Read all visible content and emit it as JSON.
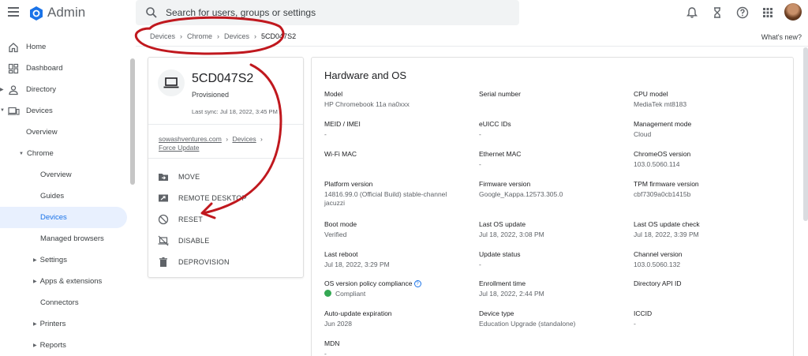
{
  "app": {
    "title": "Admin"
  },
  "search": {
    "placeholder": "Search for users, groups or settings"
  },
  "header_icons": [
    "bell-icon",
    "hourglass-icon",
    "help-icon",
    "apps-grid-icon"
  ],
  "sidebar": {
    "items": [
      {
        "label": "Home"
      },
      {
        "label": "Dashboard"
      },
      {
        "label": "Directory"
      },
      {
        "label": "Devices"
      },
      {
        "label": "Overview"
      },
      {
        "label": "Chrome"
      },
      {
        "label": "Overview"
      },
      {
        "label": "Guides"
      },
      {
        "label": "Devices"
      },
      {
        "label": "Managed browsers"
      },
      {
        "label": "Settings"
      },
      {
        "label": "Apps & extensions"
      },
      {
        "label": "Connectors"
      },
      {
        "label": "Printers"
      },
      {
        "label": "Reports"
      }
    ]
  },
  "breadcrumb": {
    "items": [
      "Devices",
      "Chrome",
      "Devices",
      "5CD047S2"
    ],
    "whats_new": "What's new?"
  },
  "device": {
    "name": "5CD047S2",
    "status": "Provisioned",
    "last_sync": "Last sync: Jul 18, 2022, 3:45 PM",
    "org_path_1": "sowashventures.com",
    "org_path_2": "Devices",
    "org_path_3": "Force Update",
    "actions": [
      "MOVE",
      "REMOTE DESKTOP",
      "RESET",
      "DISABLE",
      "DEPROVISION"
    ]
  },
  "hardware": {
    "title": "Hardware and OS",
    "fields": [
      {
        "key": "Model",
        "value": "HP Chromebook 11a na0xxx"
      },
      {
        "key": "Serial number",
        "value": ""
      },
      {
        "key": "CPU model",
        "value": "MediaTek mt8183"
      },
      {
        "key": "MEID / IMEI",
        "value": "-"
      },
      {
        "key": "eUICC IDs",
        "value": "-"
      },
      {
        "key": "Management mode",
        "value": "Cloud"
      },
      {
        "key": "Wi-Fi MAC",
        "value": ""
      },
      {
        "key": "Ethernet MAC",
        "value": "-"
      },
      {
        "key": "ChromeOS version",
        "value": "103.0.5060.114"
      },
      {
        "key": "Platform version",
        "value": "14816.99.0 (Official Build) stable-channel",
        "value2": "jacuzzi"
      },
      {
        "key": "Firmware version",
        "value": "Google_Kappa.12573.305.0"
      },
      {
        "key": "TPM firmware version",
        "value": "cbf7309a0cb1415b"
      },
      {
        "key": "Boot mode",
        "value": "Verified"
      },
      {
        "key": "Last OS update",
        "value": "Jul 18, 2022, 3:08 PM"
      },
      {
        "key": "Last OS update check",
        "value": "Jul 18, 2022, 3:39 PM"
      },
      {
        "key": "Last reboot",
        "value": "Jul 18, 2022, 3:29 PM"
      },
      {
        "key": "Update status",
        "value": "-"
      },
      {
        "key": "Channel version",
        "value": "103.0.5060.132"
      },
      {
        "key": "OS version policy compliance",
        "value": "Compliant"
      },
      {
        "key": "Enrollment time",
        "value": "Jul 18, 2022, 2:44 PM"
      },
      {
        "key": "Directory API ID",
        "value": ""
      },
      {
        "key": "Auto-update expiration",
        "value": "Jun 2028"
      },
      {
        "key": "Device type",
        "value": "Education Upgrade (standalone)"
      },
      {
        "key": "ICCID",
        "value": "-"
      },
      {
        "key": "MDN",
        "value": "-"
      }
    ]
  },
  "colors": {
    "accent": "#1a73e8",
    "annotation": "#c0181e",
    "compliant": "#34a853"
  }
}
